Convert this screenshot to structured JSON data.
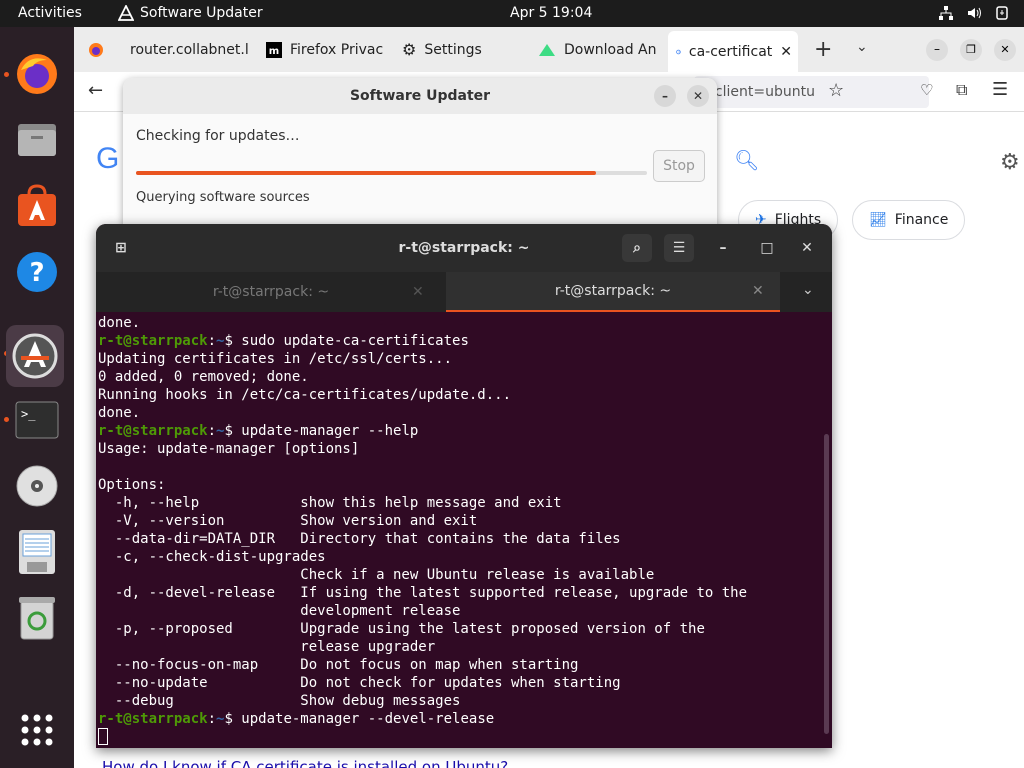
{
  "topbar": {
    "activities": "Activities",
    "app_name": "Software Updater",
    "clock": "Apr 5  19:04"
  },
  "dock": {
    "items": [
      "firefox-icon",
      "files-icon",
      "app-center-icon",
      "help-icon",
      "software-updater-icon",
      "terminal-icon",
      "disc-icon",
      "document-icon",
      "trash-icon",
      "show-apps-icon"
    ]
  },
  "browser": {
    "tabs": [
      {
        "label": "router.collabnet.l"
      },
      {
        "label": "Firefox Privac"
      },
      {
        "label": "Settings"
      },
      {
        "label": "Download An"
      },
      {
        "label": "ca-certificat"
      }
    ],
    "url": "&client=ubuntu",
    "chips": [
      {
        "label": "Flights"
      },
      {
        "label": "Finance"
      }
    ],
    "bottom_link": "How do I know if CA certificate is installed on Ubuntu?"
  },
  "updater": {
    "title": "Software Updater",
    "status": "Checking for updates…",
    "progress": 0.9,
    "stop_label": "Stop",
    "substatus": "Querying software sources"
  },
  "terminal": {
    "title": "r-t@starrpack: ~",
    "tabs": [
      {
        "label": "r-t@starrpack: ~"
      },
      {
        "label": "r-t@starrpack: ~"
      }
    ],
    "prompt": "r-t@starrpack",
    "lines": [
      {
        "t": "out",
        "text": "done."
      },
      {
        "t": "cmd",
        "text": "sudo update-ca-certificates"
      },
      {
        "t": "out",
        "text": "Updating certificates in /etc/ssl/certs..."
      },
      {
        "t": "out",
        "text": "0 added, 0 removed; done."
      },
      {
        "t": "out",
        "text": "Running hooks in /etc/ca-certificates/update.d..."
      },
      {
        "t": "out",
        "text": "done."
      },
      {
        "t": "cmd",
        "text": "update-manager --help"
      },
      {
        "t": "out",
        "text": "Usage: update-manager [options]"
      },
      {
        "t": "out",
        "text": ""
      },
      {
        "t": "out",
        "text": "Options:"
      },
      {
        "t": "out",
        "text": "  -h, --help            show this help message and exit"
      },
      {
        "t": "out",
        "text": "  -V, --version         Show version and exit"
      },
      {
        "t": "out",
        "text": "  --data-dir=DATA_DIR   Directory that contains the data files"
      },
      {
        "t": "out",
        "text": "  -c, --check-dist-upgrades"
      },
      {
        "t": "out",
        "text": "                        Check if a new Ubuntu release is available"
      },
      {
        "t": "out",
        "text": "  -d, --devel-release   If using the latest supported release, upgrade to the"
      },
      {
        "t": "out",
        "text": "                        development release"
      },
      {
        "t": "out",
        "text": "  -p, --proposed        Upgrade using the latest proposed version of the"
      },
      {
        "t": "out",
        "text": "                        release upgrader"
      },
      {
        "t": "out",
        "text": "  --no-focus-on-map     Do not focus on map when starting"
      },
      {
        "t": "out",
        "text": "  --no-update           Do not check for updates when starting"
      },
      {
        "t": "out",
        "text": "  --debug               Show debug messages"
      },
      {
        "t": "cmd",
        "text": "update-manager --devel-release"
      }
    ]
  }
}
